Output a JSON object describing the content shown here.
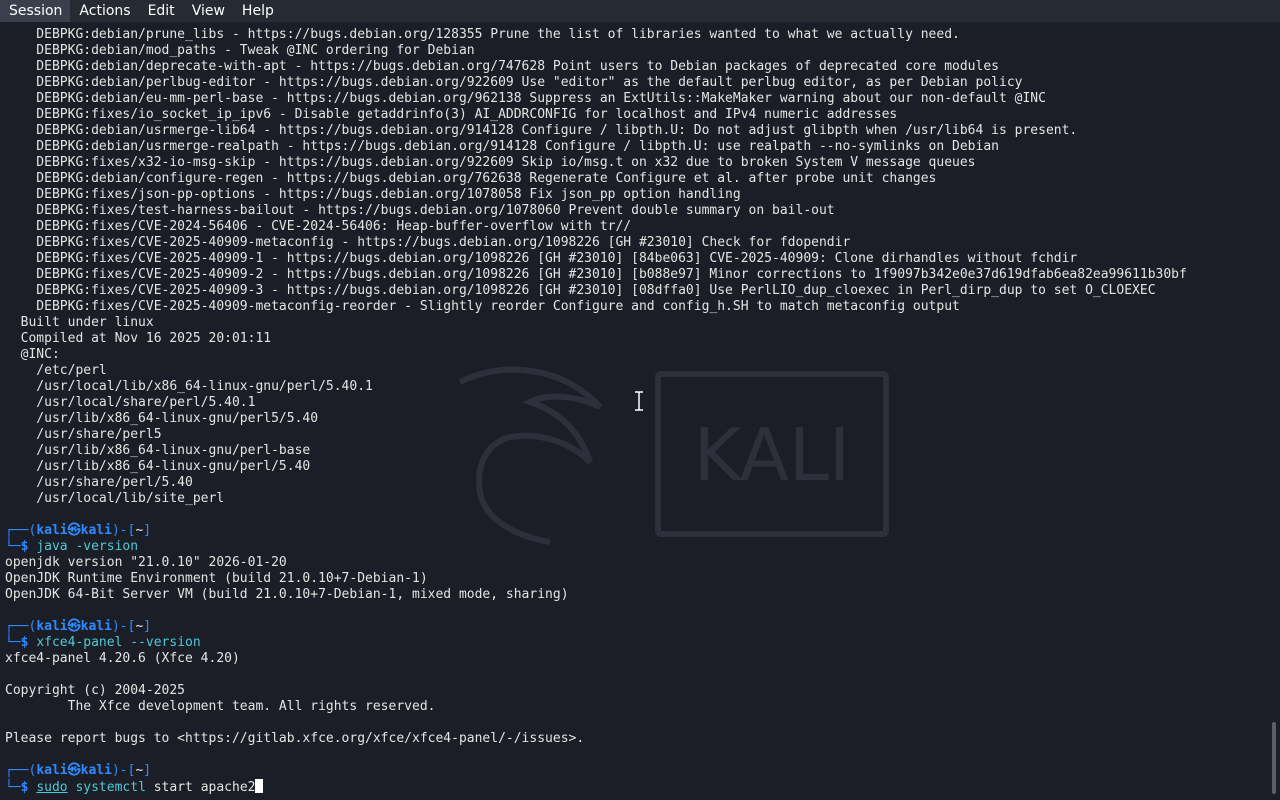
{
  "menubar": {
    "items": [
      "Session",
      "Actions",
      "Edit",
      "View",
      "Help"
    ]
  },
  "colors": {
    "background": "#1b1e26",
    "prompt_blue": "#2e8bff",
    "command_cyan": "#4ec9d6",
    "text": "#e4e4e4"
  },
  "watermark": {
    "text": "KALI",
    "icon": "kali-dragon-icon"
  },
  "output_lines": [
    "    DEBPKG:debian/prune_libs - https://bugs.debian.org/128355 Prune the list of libraries wanted to what we actually need.",
    "    DEBPKG:debian/mod_paths - Tweak @INC ordering for Debian",
    "    DEBPKG:debian/deprecate-with-apt - https://bugs.debian.org/747628 Point users to Debian packages of deprecated core modules",
    "    DEBPKG:debian/perlbug-editor - https://bugs.debian.org/922609 Use \"editor\" as the default perlbug editor, as per Debian policy",
    "    DEBPKG:debian/eu-mm-perl-base - https://bugs.debian.org/962138 Suppress an ExtUtils::MakeMaker warning about our non-default @INC",
    "    DEBPKG:fixes/io_socket_ip_ipv6 - Disable getaddrinfo(3) AI_ADDRCONFIG for localhost and IPv4 numeric addresses",
    "    DEBPKG:debian/usrmerge-lib64 - https://bugs.debian.org/914128 Configure / libpth.U: Do not adjust glibpth when /usr/lib64 is present.",
    "    DEBPKG:debian/usrmerge-realpath - https://bugs.debian.org/914128 Configure / libpth.U: use realpath --no-symlinks on Debian",
    "    DEBPKG:fixes/x32-io-msg-skip - https://bugs.debian.org/922609 Skip io/msg.t on x32 due to broken System V message queues",
    "    DEBPKG:debian/configure-regen - https://bugs.debian.org/762638 Regenerate Configure et al. after probe unit changes",
    "    DEBPKG:fixes/json-pp-options - https://bugs.debian.org/1078058 Fix json_pp option handling",
    "    DEBPKG:fixes/test-harness-bailout - https://bugs.debian.org/1078060 Prevent double summary on bail-out",
    "    DEBPKG:fixes/CVE-2024-56406 - CVE-2024-56406: Heap-buffer-overflow with tr//",
    "    DEBPKG:fixes/CVE-2025-40909-metaconfig - https://bugs.debian.org/1098226 [GH #23010] Check for fdopendir",
    "    DEBPKG:fixes/CVE-2025-40909-1 - https://bugs.debian.org/1098226 [GH #23010] [84be063] CVE-2025-40909: Clone dirhandles without fchdir",
    "    DEBPKG:fixes/CVE-2025-40909-2 - https://bugs.debian.org/1098226 [GH #23010] [b088e97] Minor corrections to 1f9097b342e0e37d619dfab6ea82ea99611b30bf",
    "    DEBPKG:fixes/CVE-2025-40909-3 - https://bugs.debian.org/1098226 [GH #23010] [08dffa0] Use PerlLIO_dup_cloexec in Perl_dirp_dup to set O_CLOEXEC",
    "    DEBPKG:fixes/CVE-2025-40909-metaconfig-reorder - Slightly reorder Configure and config_h.SH to match metaconfig output",
    "  Built under linux",
    "  Compiled at Nov 16 2025 20:01:11",
    "  @INC:",
    "    /etc/perl",
    "    /usr/local/lib/x86_64-linux-gnu/perl/5.40.1",
    "    /usr/local/share/perl/5.40.1",
    "    /usr/lib/x86_64-linux-gnu/perl5/5.40",
    "    /usr/share/perl5",
    "    /usr/lib/x86_64-linux-gnu/perl-base",
    "    /usr/lib/x86_64-linux-gnu/perl/5.40",
    "    /usr/share/perl/5.40",
    "    /usr/local/lib/site_perl",
    ""
  ],
  "prompt": {
    "top_prefix": "┌──(",
    "user": "kali",
    "at": "㉿",
    "host": "kali",
    "mid": ")-[",
    "dir": "~",
    "end": "]",
    "bottom_prefix": "└─",
    "dollar": "$ "
  },
  "block1": {
    "command": "java",
    "args": " -version",
    "output": [
      "openjdk version \"21.0.10\" 2026-01-20",
      "OpenJDK Runtime Environment (build 21.0.10+7-Debian-1)",
      "OpenJDK 64-Bit Server VM (build 21.0.10+7-Debian-1, mixed mode, sharing)",
      ""
    ]
  },
  "block2": {
    "command": "xfce4-panel",
    "args": " --version",
    "output": [
      "xfce4-panel 4.20.6 (Xfce 4.20)",
      "",
      "Copyright (c) 2004-2025",
      "        The Xfce development team. All rights reserved.",
      "",
      "Please report bugs to <https://gitlab.xfce.org/xfce/xfce4-panel/-/issues>.",
      ""
    ]
  },
  "block3": {
    "sudo": "sudo",
    "command": " systemctl",
    "args": " start apache2"
  }
}
